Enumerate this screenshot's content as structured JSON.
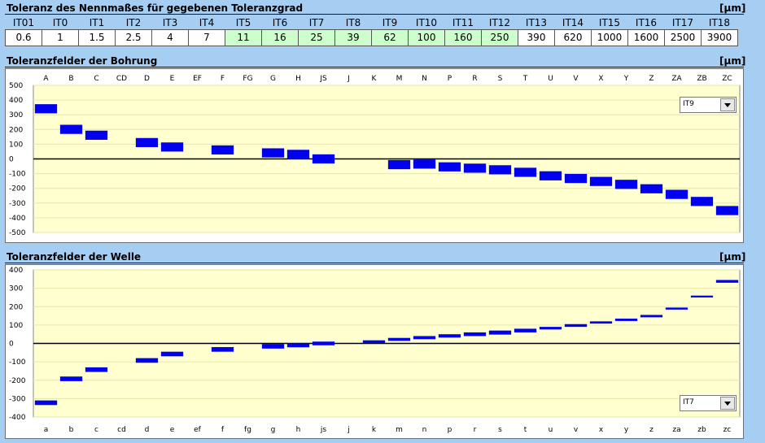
{
  "header": {
    "title": "Toleranz des Nennmaßes für gegebenen Toleranzgrad",
    "unit": "[µm]",
    "grades": [
      "IT01",
      "IT0",
      "IT1",
      "IT2",
      "IT3",
      "IT4",
      "IT5",
      "IT6",
      "IT7",
      "IT8",
      "IT9",
      "IT10",
      "IT11",
      "IT12",
      "IT13",
      "IT14",
      "IT15",
      "IT16",
      "IT17",
      "IT18"
    ],
    "values": [
      "0.6",
      "1",
      "1.5",
      "2.5",
      "4",
      "7",
      "11",
      "16",
      "25",
      "39",
      "62",
      "100",
      "160",
      "250",
      "390",
      "620",
      "1000",
      "1600",
      "2500",
      "3900"
    ],
    "highlight_color": "#ccffcc",
    "highlighted_grades": [
      "IT5",
      "IT6",
      "IT7",
      "IT8",
      "IT9",
      "IT10",
      "IT11",
      "IT12"
    ]
  },
  "bore": {
    "title": "Toleranzfelder der Bohrung",
    "unit": "[µm]",
    "dropdown_value": "IT9"
  },
  "shaft": {
    "title": "Toleranzfelder der Welle",
    "unit": "[µm]",
    "dropdown_value": "IT7"
  },
  "chart_data": [
    {
      "type": "bar",
      "title": "Toleranzfelder der Bohrung",
      "categories": [
        "A",
        "B",
        "C",
        "CD",
        "D",
        "E",
        "EF",
        "F",
        "FG",
        "G",
        "H",
        "JS",
        "J",
        "K",
        "M",
        "N",
        "P",
        "R",
        "S",
        "T",
        "U",
        "V",
        "X",
        "Y",
        "Z",
        "ZA",
        "ZB",
        "ZC"
      ],
      "lower": [
        310,
        170,
        130,
        0,
        80,
        50,
        0,
        30,
        0,
        10,
        0,
        -31,
        0,
        0,
        -70,
        -66,
        -85,
        -94,
        -105,
        -122,
        -146,
        -164,
        -184,
        -204,
        -234,
        -272,
        -320,
        -382
      ],
      "upper": [
        372,
        232,
        192,
        0,
        142,
        112,
        0,
        92,
        0,
        72,
        62,
        31,
        0,
        0,
        -8,
        -4,
        -23,
        -32,
        -43,
        -60,
        -84,
        -102,
        -122,
        -142,
        -172,
        -210,
        -258,
        -320
      ],
      "ylim": [
        -500,
        500
      ],
      "yticks": [
        500,
        400,
        300,
        200,
        100,
        0,
        -100,
        -200,
        -300,
        -400,
        -500
      ],
      "bar_color": "#0000ee",
      "plot_bg": "#ffffd0"
    },
    {
      "type": "bar",
      "title": "Toleranzfelder der Welle",
      "categories": [
        "a",
        "b",
        "c",
        "cd",
        "d",
        "e",
        "ef",
        "f",
        "fg",
        "g",
        "h",
        "js",
        "j",
        "k",
        "m",
        "n",
        "p",
        "r",
        "s",
        "t",
        "u",
        "v",
        "x",
        "y",
        "z",
        "za",
        "zb",
        "zc"
      ],
      "lower": [
        -335,
        -205,
        -155,
        0,
        -105,
        -70,
        0,
        -45,
        0,
        -28,
        -21,
        -10,
        0,
        2,
        14,
        23,
        32,
        40,
        48,
        60,
        76,
        90,
        108,
        122,
        142,
        184,
        250,
        330
      ],
      "upper": [
        -310,
        -180,
        -130,
        0,
        -80,
        -45,
        0,
        -20,
        0,
        -3,
        0,
        10,
        0,
        17,
        30,
        40,
        50,
        60,
        70,
        80,
        90,
        105,
        120,
        135,
        155,
        195,
        260,
        345
      ],
      "ylim": [
        -400,
        400
      ],
      "yticks": [
        400,
        300,
        200,
        100,
        0,
        -100,
        -200,
        -300,
        -400
      ],
      "bar_color": "#0000ee",
      "plot_bg": "#ffffd0"
    }
  ]
}
